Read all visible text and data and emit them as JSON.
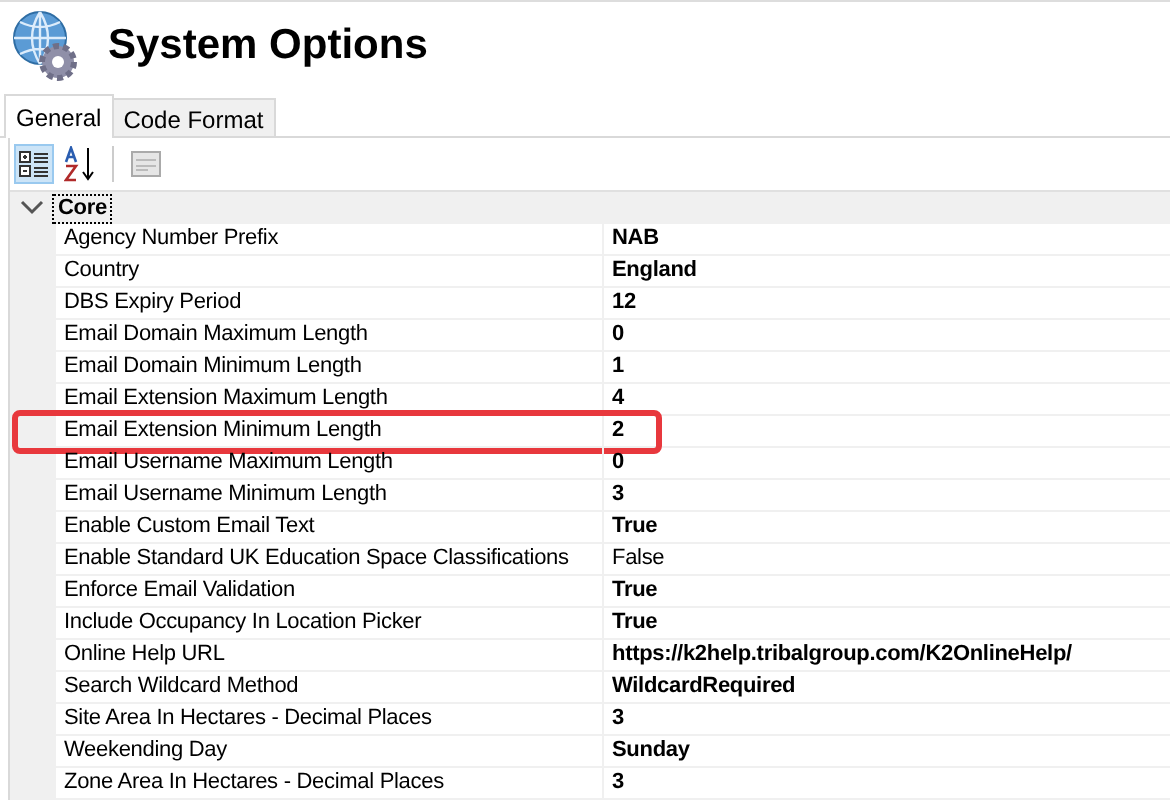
{
  "window": {
    "title": "System Options"
  },
  "tabs": [
    {
      "label": "General",
      "selected": true
    },
    {
      "label": "Code Format",
      "selected": false
    }
  ],
  "toolbar": {
    "categorized_selected": true,
    "alphabetical_selected": false,
    "property_pages_disabled": true
  },
  "grid": {
    "category": {
      "label": "Core",
      "expanded": true
    },
    "rows": [
      {
        "name": "Agency Number Prefix",
        "value": "NAB",
        "modified": true,
        "highlighted": false
      },
      {
        "name": "Country",
        "value": "England",
        "modified": true,
        "highlighted": false
      },
      {
        "name": "DBS Expiry Period",
        "value": "12",
        "modified": true,
        "highlighted": false
      },
      {
        "name": "Email Domain Maximum Length",
        "value": "0",
        "modified": true,
        "highlighted": false
      },
      {
        "name": "Email Domain Minimum Length",
        "value": "1",
        "modified": true,
        "highlighted": false
      },
      {
        "name": "Email Extension Maximum Length",
        "value": "4",
        "modified": true,
        "highlighted": false
      },
      {
        "name": "Email Extension Minimum Length",
        "value": "2",
        "modified": true,
        "highlighted": true
      },
      {
        "name": "Email Username Maximum Length",
        "value": "0",
        "modified": true,
        "highlighted": false
      },
      {
        "name": "Email Username Minimum Length",
        "value": "3",
        "modified": true,
        "highlighted": false
      },
      {
        "name": "Enable Custom Email Text",
        "value": "True",
        "modified": true,
        "highlighted": false
      },
      {
        "name": "Enable Standard UK Education Space Classifications",
        "value": "False",
        "modified": false,
        "highlighted": false
      },
      {
        "name": "Enforce Email Validation",
        "value": "True",
        "modified": true,
        "highlighted": false
      },
      {
        "name": "Include Occupancy In Location Picker",
        "value": "True",
        "modified": true,
        "highlighted": false
      },
      {
        "name": "Online Help URL",
        "value": "https://k2help.tribalgroup.com/K2OnlineHelp/",
        "modified": true,
        "highlighted": false
      },
      {
        "name": "Search Wildcard Method",
        "value": "WildcardRequired",
        "modified": true,
        "highlighted": false
      },
      {
        "name": "Site Area In Hectares - Decimal Places",
        "value": "3",
        "modified": true,
        "highlighted": false
      },
      {
        "name": "Weekending Day",
        "value": "Sunday",
        "modified": true,
        "highlighted": false
      },
      {
        "name": "Zone Area In Hectares - Decimal Places",
        "value": "3",
        "modified": true,
        "highlighted": false
      }
    ]
  }
}
